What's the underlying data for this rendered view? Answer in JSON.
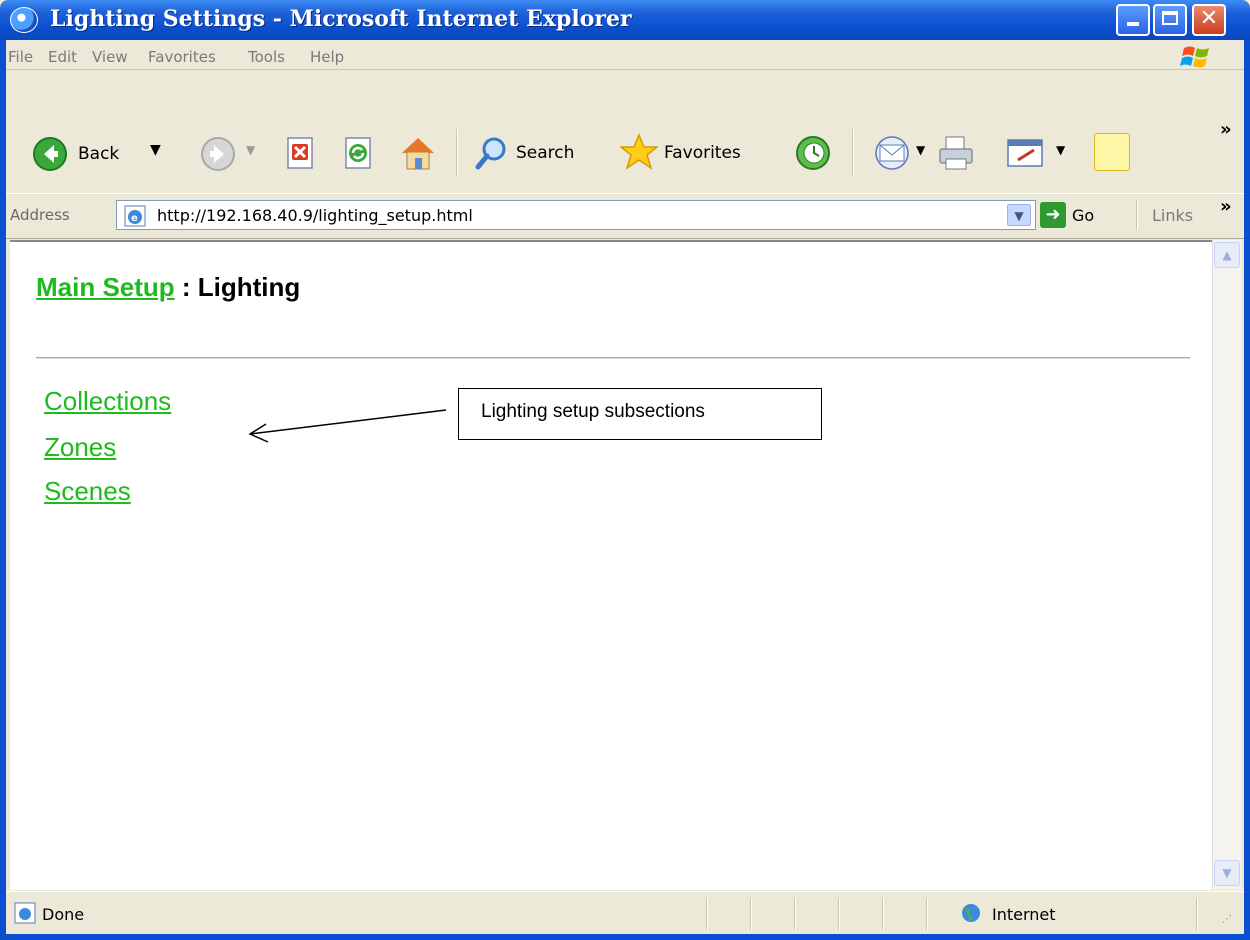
{
  "window": {
    "title": "Lighting Settings - Microsoft Internet Explorer",
    "controls": [
      "minimize",
      "maximize",
      "close"
    ]
  },
  "menu": {
    "items": [
      {
        "label": "File",
        "accel": "F"
      },
      {
        "label": "Edit",
        "accel": "E"
      },
      {
        "label": "View",
        "accel": "V"
      },
      {
        "label": "Favorites",
        "accel": "a"
      },
      {
        "label": "Tools",
        "accel": "T"
      },
      {
        "label": "Help",
        "accel": "H"
      }
    ]
  },
  "toolbar": {
    "back_label": "Back",
    "search_label": "Search",
    "favorites_label": "Favorites",
    "overflow": "»"
  },
  "address": {
    "label": "Address",
    "url": "http://192.168.40.9/lighting_setup.html",
    "go_label": "Go",
    "links_label": "Links",
    "overflow": "»"
  },
  "page": {
    "breadcrumb_link": "Main Setup",
    "breadcrumb_sep": " : ",
    "breadcrumb_current": "Lighting",
    "subsections": [
      "Collections",
      "Zones",
      "Scenes"
    ],
    "link_color": "#1EBA1E"
  },
  "annotation": {
    "text": "Lighting setup subsections"
  },
  "status": {
    "text": "Done",
    "zone": "Internet"
  },
  "colors": {
    "titlebar": "#0A4FD0",
    "chrome": "#ECE9D8"
  }
}
